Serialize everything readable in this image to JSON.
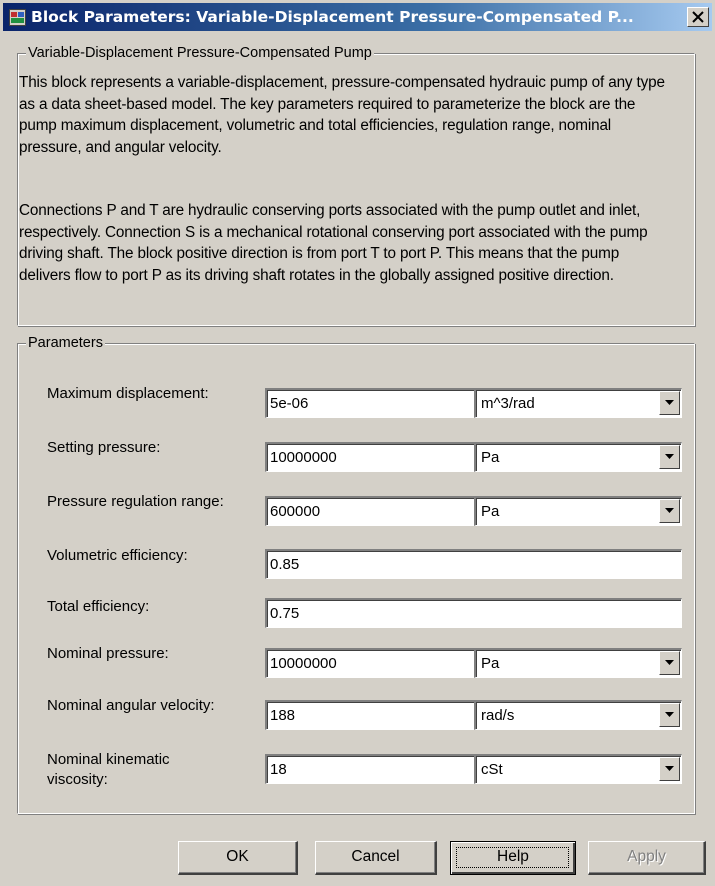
{
  "window": {
    "title": "Block Parameters: Variable-Displacement Pressure-Compensated P...",
    "close_icon": "close-icon"
  },
  "description": {
    "legend": "Variable-Displacement Pressure-Compensated Pump",
    "paragraph1": "This block represents a  variable-displacement, pressure-compensated hydrauic pump of any type as a data sheet-based model. The key parameters required to parameterize the block are the pump maximum displacement, volumetric and total efficiencies, regulation range, nominal pressure, and angular velocity.",
    "paragraph2": "Connections P and T are hydraulic conserving ports associated with the pump outlet and inlet, respectively. Connection S is a mechanical rotational conserving port associated with the pump driving shaft. The block positive direction is from port T to port P. This means that the pump delivers flow to port P as its driving shaft rotates in the globally assigned positive direction."
  },
  "parameters": {
    "legend": "Parameters",
    "rows": [
      {
        "label": "Maximum displacement:",
        "value": "5e-06",
        "unit": "m^3/rad"
      },
      {
        "label": "Setting pressure:",
        "value": "10000000",
        "unit": "Pa"
      },
      {
        "label": "Pressure regulation range:",
        "value": "600000",
        "unit": "Pa"
      },
      {
        "label": "Volumetric efficiency:",
        "value": "0.85"
      },
      {
        "label": "Total efficiency:",
        "value": "0.75"
      },
      {
        "label": "Nominal pressure:",
        "value": "10000000",
        "unit": "Pa"
      },
      {
        "label": "Nominal angular velocity:",
        "value": "188",
        "unit": "rad/s"
      },
      {
        "label": "Nominal kinematic viscosity:",
        "label_line1": "Nominal kinematic",
        "label_line2": "viscosity:",
        "value": "18",
        "unit": "cSt"
      }
    ]
  },
  "buttons": {
    "ok": "OK",
    "cancel": "Cancel",
    "help": "Help",
    "apply": "Apply"
  }
}
